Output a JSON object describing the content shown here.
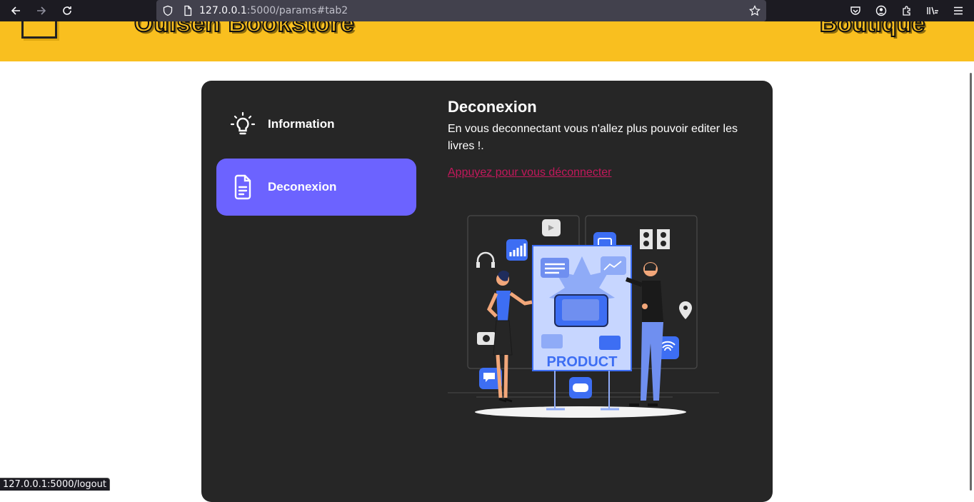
{
  "browser": {
    "url_host": "127.0.0.1",
    "url_rest": ":5000/params#tab2",
    "status_url": "127.0.0.1:5000/logout"
  },
  "header": {
    "title": "Oulsen Bookstore",
    "right": "Boutique"
  },
  "tabs": [
    {
      "label": "Information",
      "icon": "lightbulb-icon",
      "active": false
    },
    {
      "label": "Deconexion",
      "icon": "document-icon",
      "active": true
    }
  ],
  "content": {
    "title": "Deconexion",
    "text": "En vous deconnectant vous n'allez plus pouvoir editer les livres !.",
    "link": "Appuyez pour vous déconnecter"
  },
  "illustration": {
    "board_text": "PRODUCT"
  },
  "colors": {
    "header": "#f9bf1f",
    "card": "#262626",
    "accent": "#6c63ff",
    "link": "#c2185b"
  }
}
